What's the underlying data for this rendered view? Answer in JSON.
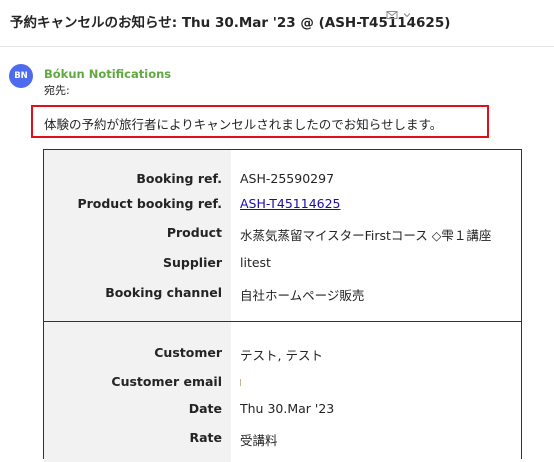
{
  "email": {
    "subject": "予約キャンセルのお知らせ: Thu 30.Mar '23 @ (ASH-T45114625)",
    "sender_initials": "BN",
    "sender_name": "Bókun Notifications",
    "to_label": "宛先:",
    "notice": "体験の予約が旅行者によりキャンセルされましたのでお知らせします。"
  },
  "header_actions": {
    "mail_icon": "envelope-icon",
    "dropdown_icon": "chevron-down-icon"
  },
  "booking": {
    "booking_ref_label": "Booking ref.",
    "booking_ref_value": "ASH-25590297",
    "product_booking_ref_label": "Product booking ref.",
    "product_booking_ref_value": "ASH-T45114625",
    "product_label": "Product",
    "product_value": "水蒸気蒸留マイスターFirstコース ◇雫１講座",
    "supplier_label": "Supplier",
    "supplier_value": "litest",
    "booking_channel_label": "Booking channel",
    "booking_channel_value": "自社ホームページ販売"
  },
  "customer": {
    "customer_label": "Customer",
    "customer_value": "テスト, テスト",
    "customer_email_label": "Customer email",
    "date_label": "Date",
    "date_value": "Thu 30.Mar '23",
    "rate_label": "Rate",
    "rate_value": "受講料"
  },
  "colors": {
    "sender_name": "#61a843",
    "avatar_bg": "#4f6bed",
    "highlight_border": "#e0101a",
    "link": "#1a0dab",
    "label_column_bg": "#f2f2f2"
  }
}
